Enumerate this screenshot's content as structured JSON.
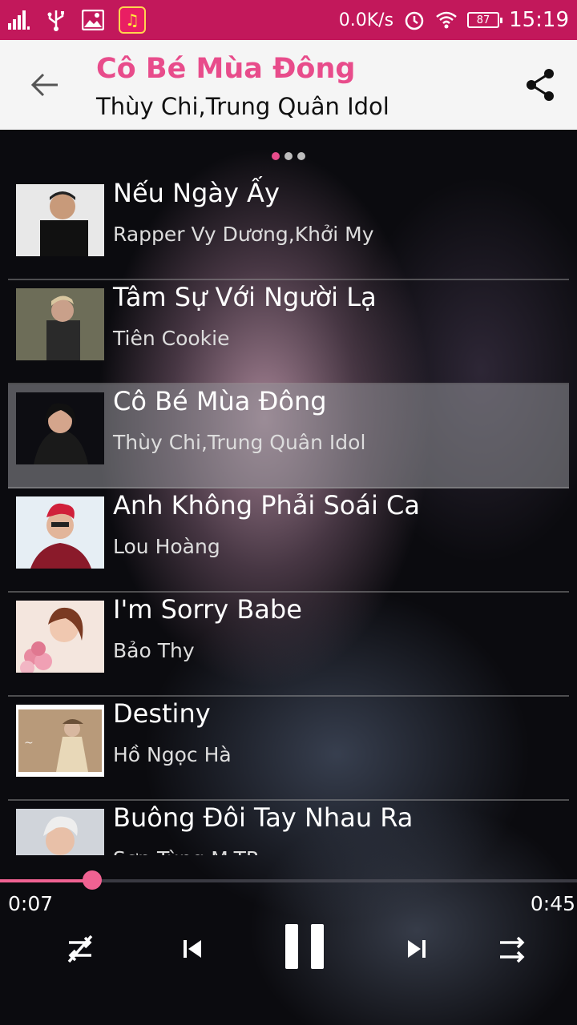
{
  "status_bar": {
    "net_speed": "0.0K/s",
    "battery": "87",
    "time": "15:19"
  },
  "header": {
    "title": "Cô Bé Mùa Đông",
    "subtitle": "Thùy Chi,Trung Quân Idol"
  },
  "pager": {
    "count": 3,
    "active_index": 0
  },
  "songs": [
    {
      "title": "Nếu Ngày Ấy",
      "artist": "Rapper Vy Dương,Khởi My"
    },
    {
      "title": "Tâm Sự Với Người Lạ",
      "artist": "Tiên Cookie"
    },
    {
      "title": "Cô Bé Mùa Đông",
      "artist": "Thùy Chi,Trung Quân Idol"
    },
    {
      "title": "Anh Không Phải Soái Ca",
      "artist": "Lou Hoàng"
    },
    {
      "title": "I'm Sorry Babe",
      "artist": "Bảo Thy"
    },
    {
      "title": "Destiny",
      "artist": "Hồ Ngọc Hà"
    },
    {
      "title": "Buông Đôi Tay Nhau Ra",
      "artist": "Sơn Tùng M-TP"
    }
  ],
  "selected_index": 2,
  "player": {
    "current_time": "0:07",
    "total_time": "0:45",
    "progress_fraction": 0.16
  },
  "colors": {
    "accent": "#e84c8b",
    "status_bar": "#c2185b",
    "header_bg": "#f5f5f5"
  }
}
